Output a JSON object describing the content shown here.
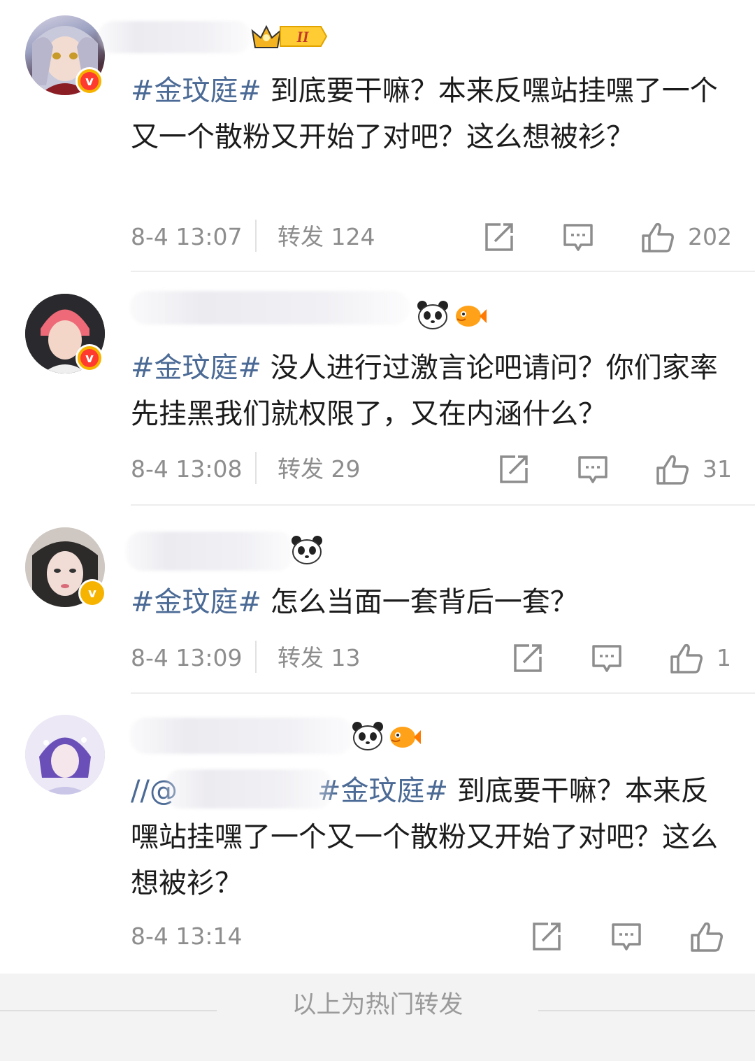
{
  "posts": [
    {
      "hashtag": "#金玟庭#",
      "text": " 到底要干嘛？本来反嘿站挂嘿了一个又一个散粉又开始了对吧？这么想被衫？",
      "time": "8-4 13:07",
      "repost": "转发 124",
      "likes": "202",
      "badge_level": "II"
    },
    {
      "hashtag": "#金玟庭#",
      "text": " 没人进行过激言论吧请问？你们家率先挂黑我们就权限了，又在内涵什么？",
      "time": "8-4 13:08",
      "repost": "转发 29",
      "likes": "31"
    },
    {
      "hashtag": "#金玟庭#",
      "text": " 怎么当面一套背后一套？",
      "time": "8-4 13:09",
      "repost": "转发 13",
      "likes": "1"
    },
    {
      "prefix": "//@",
      "hashtag": "#金玟庭#",
      "text": " 到底要干嘛？本来反嘿站挂嘿了一个又一个散粉又开始了对吧？这么想被衫？",
      "time": "8-4 13:14",
      "likes": ""
    }
  ],
  "footer": {
    "label": "以上为热门转发"
  },
  "colors": {
    "hashtag": "#4b6a95",
    "meta": "#8d8d8d",
    "badge_yellow": "#f6b400",
    "badge_red": "#ff3b2f"
  },
  "icons": [
    "repost-icon",
    "comment-icon",
    "like-icon",
    "verified-badge-icon",
    "panda-emoji",
    "fish-emoji",
    "crown-badge-icon"
  ]
}
